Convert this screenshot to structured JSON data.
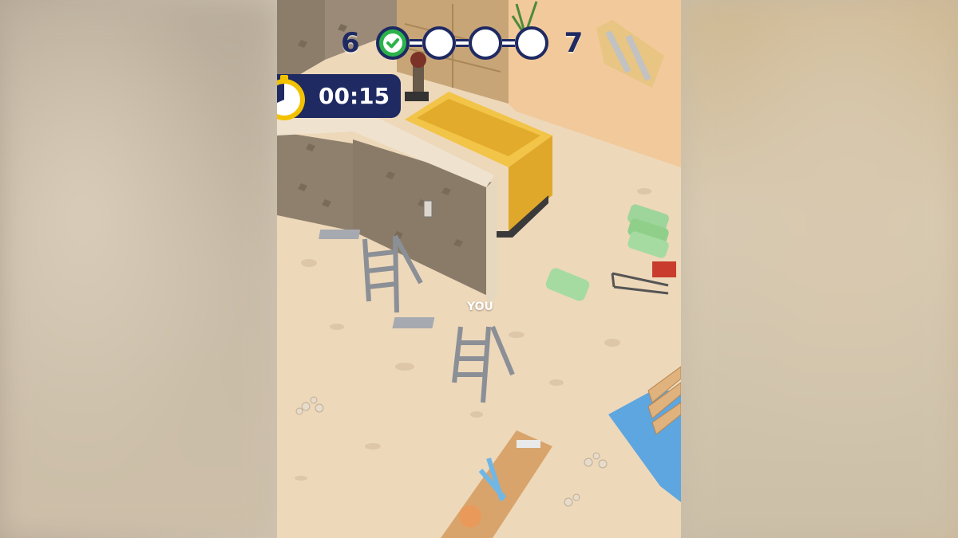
{
  "hud": {
    "current_level": "6",
    "next_level": "7",
    "stages": [
      {
        "state": "done",
        "icon": "check-icon"
      },
      {
        "state": "pending"
      },
      {
        "state": "pending"
      },
      {
        "state": "pending"
      }
    ],
    "timer": "00:15",
    "timer_icon": "stopwatch-icon"
  },
  "player_label": "YOU",
  "colors": {
    "hud_navy": "#1f2a63",
    "check_green": "#2bb34b",
    "stopwatch_yellow": "#f2c200",
    "floor_sand": "#eed9bb"
  }
}
